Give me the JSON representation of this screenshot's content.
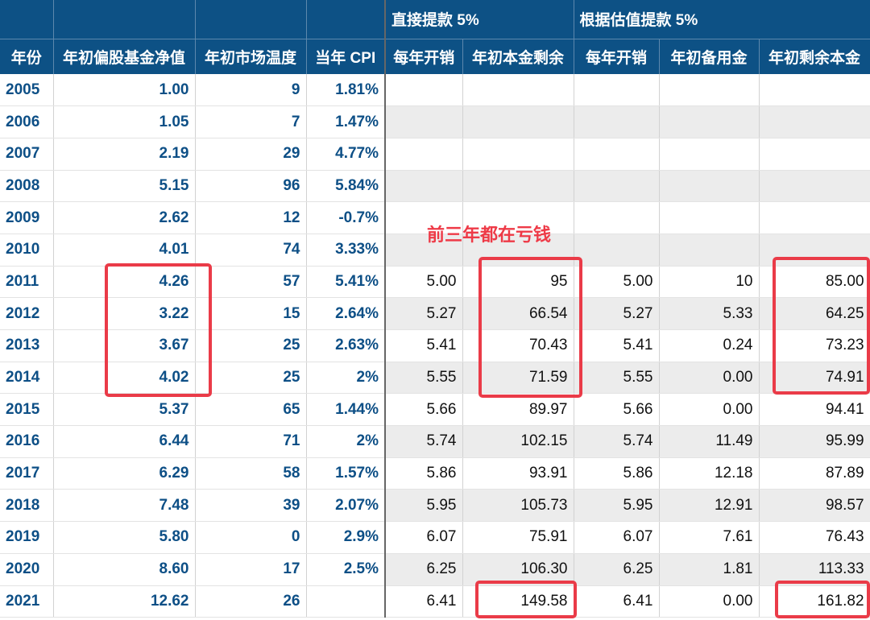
{
  "headers": {
    "group_direct": "直接提款 5%",
    "group_valuation": "根据估值提款 5%",
    "columns": [
      "年份",
      "年初偏股基金净值",
      "年初市场温度",
      "当年 CPI",
      "每年开销",
      "年初本金剩余",
      "每年开销",
      "年初备用金",
      "年初剩余本金"
    ]
  },
  "rows": [
    {
      "year": "2005",
      "nav": "1.00",
      "temp": "9",
      "cpi": "1.81%",
      "d_spend": "",
      "d_remain": "",
      "v_spend": "",
      "v_reserve": "",
      "v_remain": ""
    },
    {
      "year": "2006",
      "nav": "1.05",
      "temp": "7",
      "cpi": "1.47%",
      "d_spend": "",
      "d_remain": "",
      "v_spend": "",
      "v_reserve": "",
      "v_remain": ""
    },
    {
      "year": "2007",
      "nav": "2.19",
      "temp": "29",
      "cpi": "4.77%",
      "d_spend": "",
      "d_remain": "",
      "v_spend": "",
      "v_reserve": "",
      "v_remain": ""
    },
    {
      "year": "2008",
      "nav": "5.15",
      "temp": "96",
      "cpi": "5.84%",
      "d_spend": "",
      "d_remain": "",
      "v_spend": "",
      "v_reserve": "",
      "v_remain": ""
    },
    {
      "year": "2009",
      "nav": "2.62",
      "temp": "12",
      "cpi": "-0.7%",
      "d_spend": "",
      "d_remain": "",
      "v_spend": "",
      "v_reserve": "",
      "v_remain": ""
    },
    {
      "year": "2010",
      "nav": "4.01",
      "temp": "74",
      "cpi": "3.33%",
      "d_spend": "",
      "d_remain": "",
      "v_spend": "",
      "v_reserve": "",
      "v_remain": ""
    },
    {
      "year": "2011",
      "nav": "4.26",
      "temp": "57",
      "cpi": "5.41%",
      "d_spend": "5.00",
      "d_remain": "95",
      "v_spend": "5.00",
      "v_reserve": "10",
      "v_remain": "85.00"
    },
    {
      "year": "2012",
      "nav": "3.22",
      "temp": "15",
      "cpi": "2.64%",
      "d_spend": "5.27",
      "d_remain": "66.54",
      "v_spend": "5.27",
      "v_reserve": "5.33",
      "v_remain": "64.25"
    },
    {
      "year": "2013",
      "nav": "3.67",
      "temp": "25",
      "cpi": "2.63%",
      "d_spend": "5.41",
      "d_remain": "70.43",
      "v_spend": "5.41",
      "v_reserve": "0.24",
      "v_remain": "73.23"
    },
    {
      "year": "2014",
      "nav": "4.02",
      "temp": "25",
      "cpi": "2%",
      "d_spend": "5.55",
      "d_remain": "71.59",
      "v_spend": "5.55",
      "v_reserve": "0.00",
      "v_remain": "74.91"
    },
    {
      "year": "2015",
      "nav": "5.37",
      "temp": "65",
      "cpi": "1.44%",
      "d_spend": "5.66",
      "d_remain": "89.97",
      "v_spend": "5.66",
      "v_reserve": "0.00",
      "v_remain": "94.41"
    },
    {
      "year": "2016",
      "nav": "6.44",
      "temp": "71",
      "cpi": "2%",
      "d_spend": "5.74",
      "d_remain": "102.15",
      "v_spend": "5.74",
      "v_reserve": "11.49",
      "v_remain": "95.99"
    },
    {
      "year": "2017",
      "nav": "6.29",
      "temp": "58",
      "cpi": "1.57%",
      "d_spend": "5.86",
      "d_remain": "93.91",
      "v_spend": "5.86",
      "v_reserve": "12.18",
      "v_remain": "87.89"
    },
    {
      "year": "2018",
      "nav": "7.48",
      "temp": "39",
      "cpi": "2.07%",
      "d_spend": "5.95",
      "d_remain": "105.73",
      "v_spend": "5.95",
      "v_reserve": "12.91",
      "v_remain": "98.57"
    },
    {
      "year": "2019",
      "nav": "5.80",
      "temp": "0",
      "cpi": "2.9%",
      "d_spend": "6.07",
      "d_remain": "75.91",
      "v_spend": "6.07",
      "v_reserve": "7.61",
      "v_remain": "76.43"
    },
    {
      "year": "2020",
      "nav": "8.60",
      "temp": "17",
      "cpi": "2.5%",
      "d_spend": "6.25",
      "d_remain": "106.30",
      "v_spend": "6.25",
      "v_reserve": "1.81",
      "v_remain": "113.33"
    },
    {
      "year": "2021",
      "nav": "12.62",
      "temp": "26",
      "cpi": "",
      "d_spend": "6.41",
      "d_remain": "149.58",
      "v_spend": "6.41",
      "v_reserve": "0.00",
      "v_remain": "161.82"
    }
  ],
  "annotation": "前三年都在亏钱",
  "highlight_color": "#ea3b48"
}
